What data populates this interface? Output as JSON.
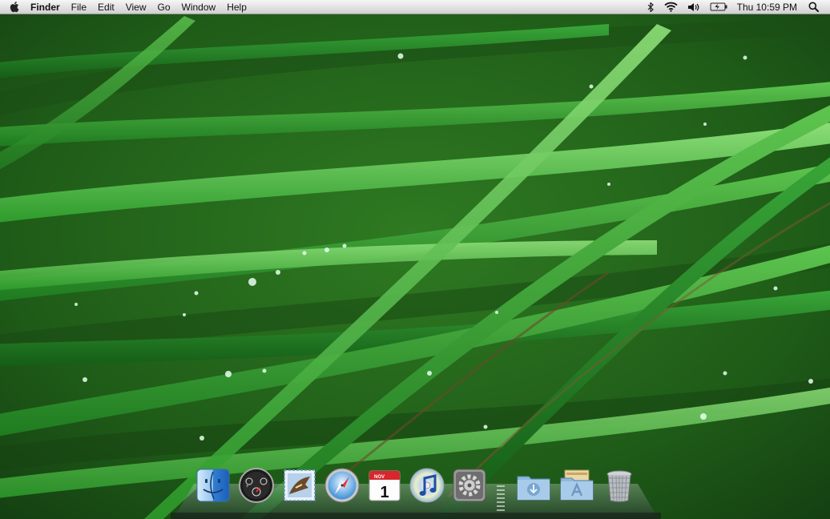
{
  "menubar": {
    "apple_icon": "apple-logo-icon",
    "app_name": "Finder",
    "menus": [
      "File",
      "Edit",
      "View",
      "Go",
      "Window",
      "Help"
    ],
    "status_icons": [
      "bluetooth-icon",
      "wifi-icon",
      "volume-icon",
      "battery-icon"
    ],
    "clock": "Thu 10:59 PM",
    "spotlight_icon": "spotlight-search-icon"
  },
  "calendar": {
    "month": "NOV",
    "day": "1"
  },
  "dock": {
    "apps": [
      "finder-icon",
      "dashboard-icon",
      "mail-icon",
      "safari-icon",
      "ical-icon",
      "itunes-icon",
      "system-preferences-icon"
    ],
    "stacks": [
      "downloads-stack-icon",
      "applications-stack-icon"
    ],
    "trash": "trash-icon"
  },
  "colors": {
    "menubar_top": "#f6f6f6",
    "menubar_bottom": "#cfcfcf",
    "wallpaper_grass": "#2f8a2b"
  }
}
